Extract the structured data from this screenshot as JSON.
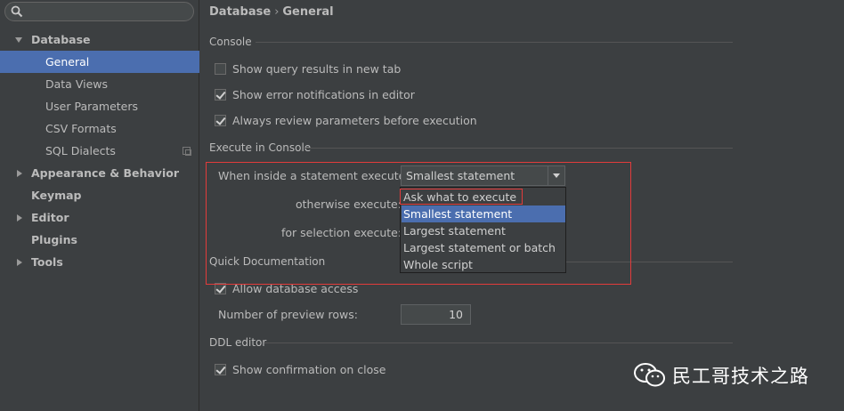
{
  "search": {
    "placeholder": ""
  },
  "sidebar": {
    "items": [
      {
        "label": "Database"
      },
      {
        "label": "General"
      },
      {
        "label": "Data Views"
      },
      {
        "label": "User Parameters"
      },
      {
        "label": "CSV Formats"
      },
      {
        "label": "SQL Dialects"
      },
      {
        "label": "Appearance & Behavior"
      },
      {
        "label": "Keymap"
      },
      {
        "label": "Editor"
      },
      {
        "label": "Plugins"
      },
      {
        "label": "Tools"
      }
    ]
  },
  "header": {
    "crumb1": "Database",
    "separator": "›",
    "crumb2": "General"
  },
  "console": {
    "title": "Console",
    "show_query_results": "Show query results in new tab",
    "show_error_notifications": "Show error notifications in editor",
    "always_review_parameters": "Always review parameters before execution"
  },
  "execute": {
    "title": "Execute in Console",
    "when_inside_label": "When inside a statement execute:",
    "otherwise_label": "otherwise execute:",
    "selection_label": "for selection execute:",
    "selected_value": "Smallest statement",
    "options": [
      "Ask what to execute",
      "Smallest statement",
      "Largest statement",
      "Largest statement or batch",
      "Whole script"
    ]
  },
  "quick_doc": {
    "title": "Quick Documentation",
    "allow_db_access": "Allow database access",
    "preview_rows_label": "Number of preview rows:",
    "preview_rows_value": "10"
  },
  "ddl": {
    "title": "DDL editor",
    "show_confirmation": "Show confirmation on close"
  },
  "watermark": {
    "text": "民工哥技术之路"
  },
  "colors": {
    "selection": "#4b6eaf",
    "highlight_border": "#e23b3b",
    "background": "#3c3f41"
  }
}
